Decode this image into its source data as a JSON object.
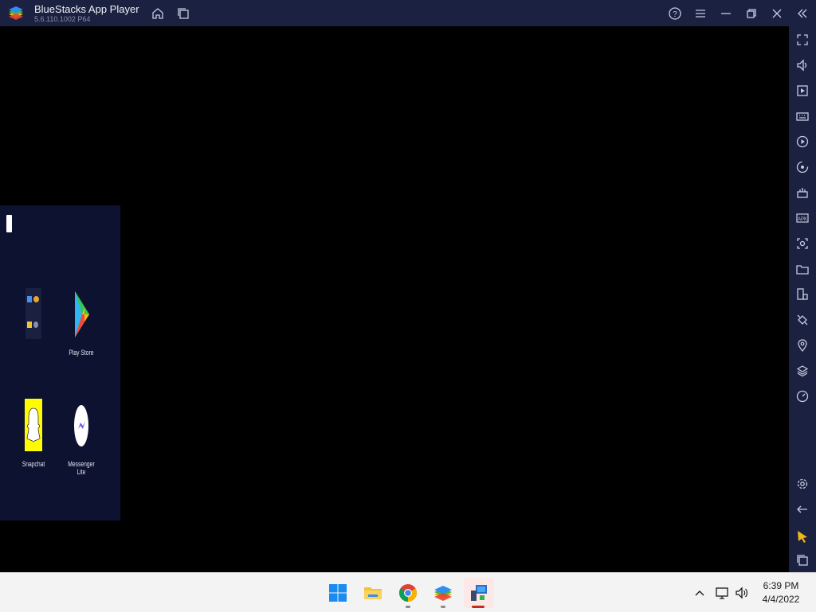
{
  "window": {
    "title": "BlueStacks App Player",
    "version": "5.6.110.1002 P64"
  },
  "android": {
    "apps": [
      {
        "label": "",
        "icon": "app-folder-icon"
      },
      {
        "label": "Play Store",
        "icon": "play-store-icon"
      },
      {
        "label": "Snapchat",
        "icon": "snapchat-icon"
      },
      {
        "label": "Messenger Lite",
        "icon": "messenger-lite-icon"
      }
    ]
  },
  "sidebar": {
    "icons": [
      "fullscreen-icon",
      "volume-icon",
      "media-manager-icon",
      "keyboard-controls-icon",
      "macro-play-icon",
      "rotate-icon",
      "game-controls-icon",
      "install-apk-icon",
      "screenshot-icon",
      "folder-icon",
      "multi-instance-icon",
      "eco-mode-icon",
      "location-icon",
      "layers-icon",
      "performance-icon",
      "settings-icon",
      "back-icon",
      "pointer-icon",
      "recent-apps-icon"
    ]
  },
  "taskbar": {
    "time": "6:39 PM",
    "date": "4/4/2022"
  },
  "colors": {
    "titlebar": "#1b2140",
    "android_bg": "#0d1230",
    "taskbar": "#f3f3f3",
    "accent_active": "#c42b1c"
  }
}
